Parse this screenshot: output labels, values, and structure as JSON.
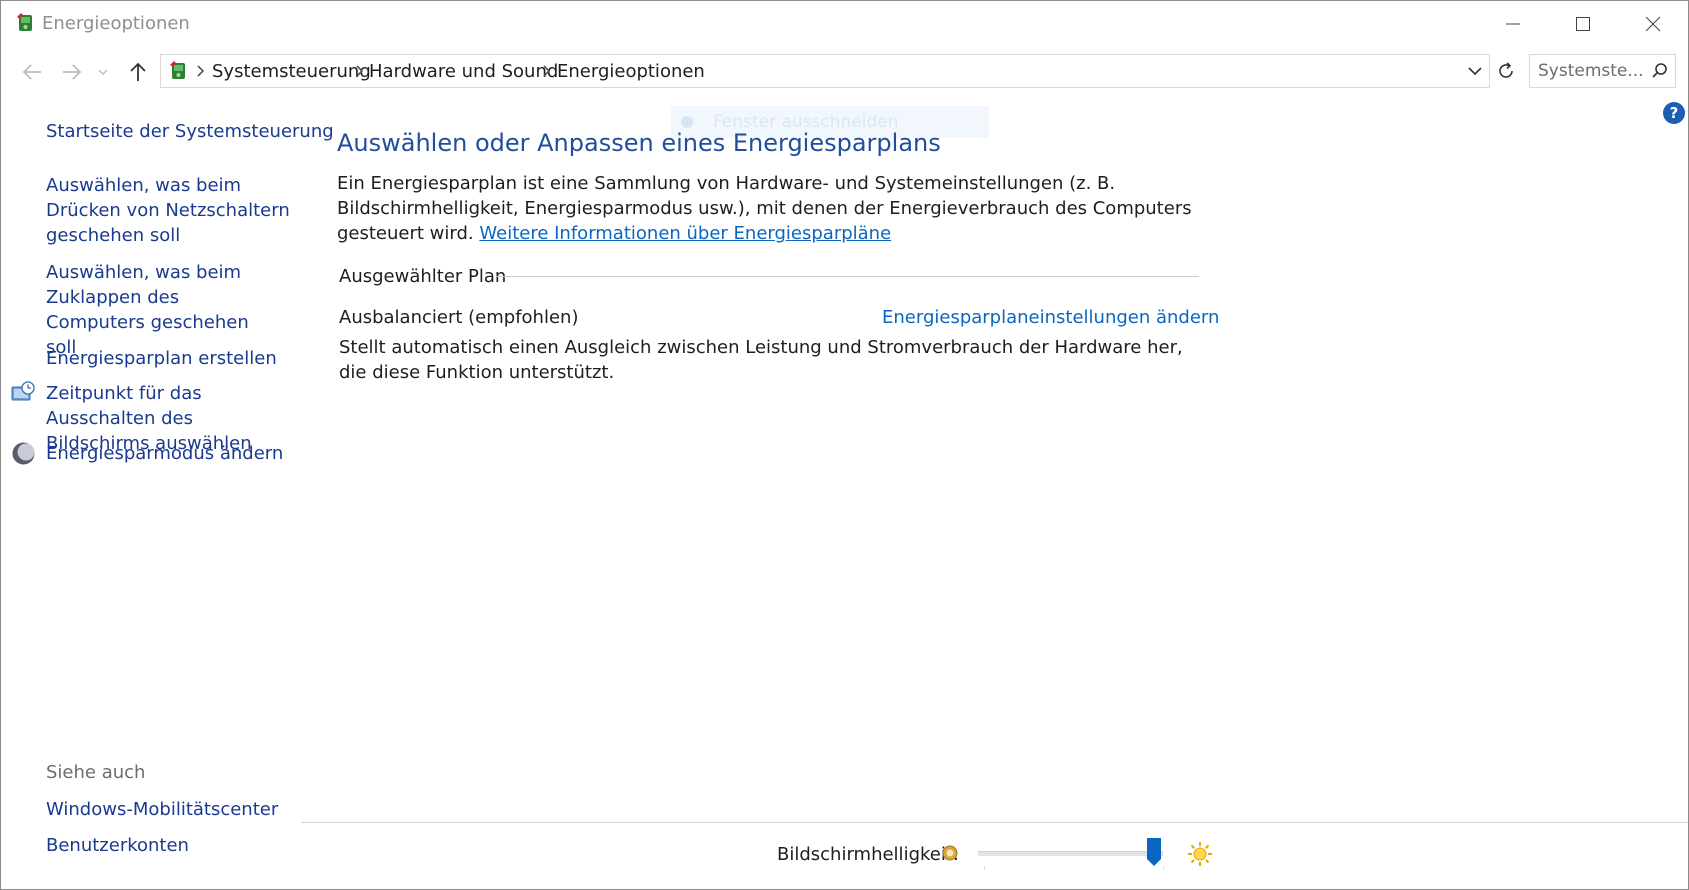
{
  "window": {
    "title": "Energieoptionen",
    "icon": "power-options-icon"
  },
  "address": {
    "crumbs": [
      "Systemsteuerung",
      "Hardware und Sound",
      "Energieoptionen"
    ]
  },
  "search": {
    "placeholder": "Systemste..."
  },
  "help": {
    "label": "?"
  },
  "sidebar": {
    "home": "Startseite der Systemsteuerung",
    "links": [
      {
        "label": "Auswählen, was beim Drücken von Netzschaltern geschehen soll"
      },
      {
        "label": "Auswählen, was beim Zuklappen des Computers geschehen soll"
      },
      {
        "label": "Energiesparplan erstellen"
      },
      {
        "label": "Zeitpunkt für das Ausschalten des Bildschirms auswählen",
        "icon": "monitor-clock-icon"
      },
      {
        "label": "Energiesparmodus ändern",
        "icon": "moon-icon"
      }
    ],
    "see_also": "Siehe auch",
    "see_also_links": [
      {
        "label": "Windows-Mobilitätscenter"
      },
      {
        "label": "Benutzerkonten"
      }
    ]
  },
  "main": {
    "heading": "Auswählen oder Anpassen eines Energiesparplans",
    "intro_text": "Ein Energiesparplan ist eine Sammlung von Hardware- und Systemeinstellungen (z. B. Bildschirmhelligkeit, Energiesparmodus usw.), mit denen der Energieverbrauch des Computers gesteuert wird.",
    "intro_link": "Weitere Informationen über Energiesparpläne",
    "ghost_tooltip": "Fenster ausschneiden",
    "section_label": "Ausgewählter Plan",
    "plan": {
      "name": "Ausbalanciert (empfohlen)",
      "change_link": "Energiesparplaneinstellungen ändern",
      "description": "Stellt automatisch einen Ausgleich zwischen Leistung und Stromverbrauch der Hardware her, die diese Funktion unterstützt."
    }
  },
  "brightness": {
    "label": "Bildschirmhelligkeit:",
    "level": 0.95
  },
  "colors": {
    "link": "#0a66c2",
    "sidebar_link": "#17398f",
    "heading": "#1f4e9c",
    "slider_thumb": "#0a66c2"
  }
}
